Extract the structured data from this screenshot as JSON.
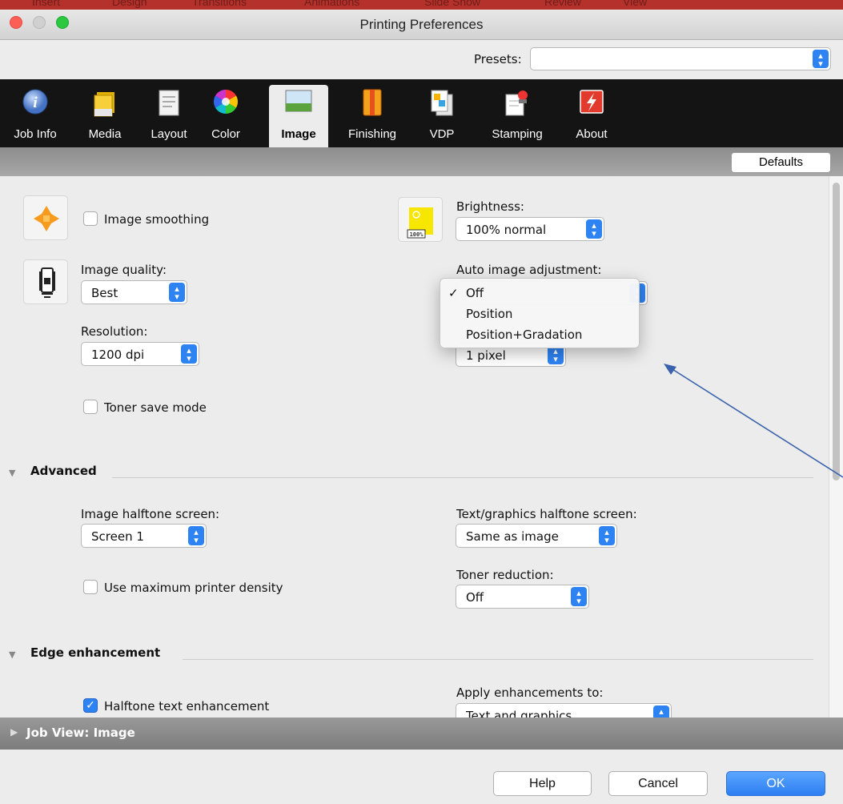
{
  "window": {
    "title": "Printing Preferences"
  },
  "background_menu": [
    "Insert",
    "Design",
    "Transitions",
    "Animations",
    "Slide Show",
    "Review",
    "View"
  ],
  "presets": {
    "label": "Presets:",
    "value": ""
  },
  "tabs": [
    {
      "label": "Job Info",
      "icon": "info-icon"
    },
    {
      "label": "Media",
      "icon": "media-icon"
    },
    {
      "label": "Layout",
      "icon": "layout-icon"
    },
    {
      "label": "Color",
      "icon": "color-wheel-icon"
    },
    {
      "label": "Image",
      "icon": "image-icon",
      "active": true
    },
    {
      "label": "Finishing",
      "icon": "finishing-icon"
    },
    {
      "label": "VDP",
      "icon": "vdp-icon"
    },
    {
      "label": "Stamping",
      "icon": "stamping-icon"
    },
    {
      "label": "About",
      "icon": "about-icon"
    }
  ],
  "defaults_label": "Defaults",
  "image": {
    "smoothing_label": "Image smoothing",
    "smoothing_checked": false,
    "quality_label": "Image quality:",
    "quality_value": "Best",
    "resolution_label": "Resolution:",
    "resolution_value": "1200 dpi",
    "toner_save_label": "Toner save mode",
    "toner_save_checked": false,
    "brightness_label": "Brightness:",
    "brightness_value": "100% normal",
    "brightness_icon_text": "100%",
    "auto_adjust_label": "Auto image adjustment:",
    "auto_adjust_options": [
      "Off",
      "Position",
      "Position+Gradation"
    ],
    "auto_adjust_selected": "Off",
    "check_mark": "✓",
    "hidden_select_value": "1 pixel"
  },
  "advanced": {
    "title": "Advanced",
    "halftone_label": "Image halftone screen:",
    "halftone_value": "Screen 1",
    "text_halftone_label": "Text/graphics halftone screen:",
    "text_halftone_value": "Same as image",
    "max_density_label": "Use maximum printer density",
    "max_density_checked": false,
    "toner_reduction_label": "Toner reduction:",
    "toner_reduction_value": "Off"
  },
  "edge": {
    "title": "Edge enhancement",
    "halftone_text_label": "Halftone text enhancement",
    "halftone_text_checked": true,
    "apply_label": "Apply enhancements to:",
    "apply_value": "Text and graphics"
  },
  "job_view": {
    "label": "Job View: Image"
  },
  "footer": {
    "help": "Help",
    "cancel": "Cancel",
    "ok": "OK"
  },
  "colors": {
    "accent": "#2e83f3",
    "toolbar": "#141414",
    "arrow": "#3b63ad"
  }
}
